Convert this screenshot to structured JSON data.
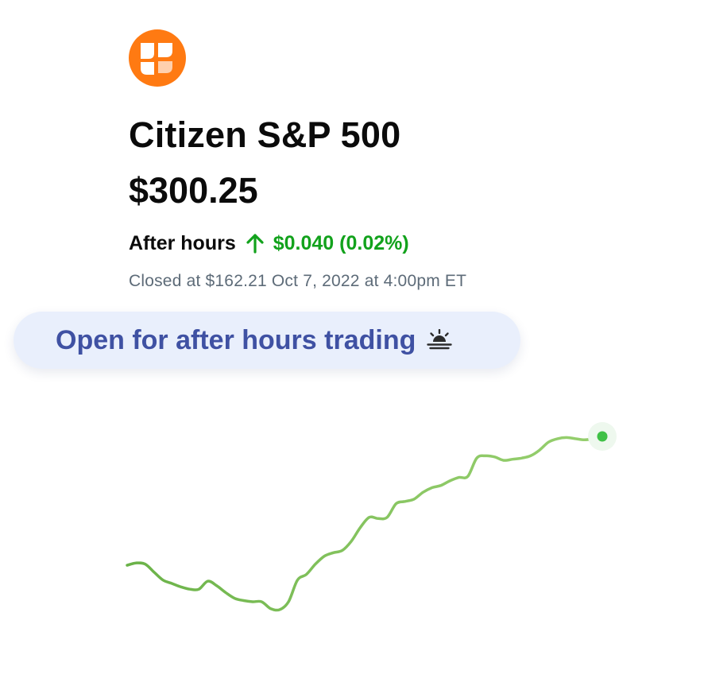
{
  "fund": {
    "logo_icon": "citizen-logo-icon",
    "name": "Citizen S&P 500",
    "price": "$300.25"
  },
  "after_hours": {
    "label": "After hours",
    "direction_icon": "arrow-up-icon",
    "change": "$0.040 (0.02%)"
  },
  "closed_text": "Closed at $162.21 Oct 7, 2022 at 4:00pm ET",
  "banner": {
    "label": "Open for after hours trading",
    "icon": "sunrise-icon"
  },
  "colors": {
    "brand_orange": "#ff7a12",
    "positive_green": "#12a21c",
    "line_green_dark": "#6ab248",
    "line_green_light": "#96cf6e",
    "banner_bg": "#e9effc",
    "banner_text": "#3f51a3",
    "muted_text": "#5d6b78"
  },
  "chart_data": {
    "type": "line",
    "title": "",
    "xlabel": "",
    "ylabel": "",
    "grid": false,
    "legend": "none",
    "note": "no axes or tick labels shown; values are relative trend readings",
    "x": [
      0,
      1,
      2,
      3,
      4,
      5,
      6,
      7,
      8,
      9,
      10,
      11,
      12,
      13,
      14,
      15,
      16,
      17,
      18,
      19,
      20,
      21,
      22,
      23,
      24,
      25,
      26,
      27,
      28,
      29,
      30,
      31,
      32,
      33,
      34,
      35,
      36,
      37,
      38,
      39,
      40,
      41,
      42,
      43,
      44,
      45,
      46,
      47,
      48,
      49,
      50,
      51,
      52,
      53
    ],
    "values": [
      54,
      56,
      55,
      48,
      41,
      38,
      35,
      33,
      33,
      40,
      36,
      30,
      25,
      23,
      22,
      22,
      16,
      15,
      22,
      41,
      46,
      55,
      62,
      65,
      67,
      75,
      87,
      96,
      95,
      96,
      108,
      110,
      112,
      118,
      122,
      124,
      128,
      131,
      132,
      148,
      150,
      149,
      146,
      147,
      148,
      150,
      155,
      162,
      165,
      166,
      165,
      164,
      165,
      167
    ]
  }
}
